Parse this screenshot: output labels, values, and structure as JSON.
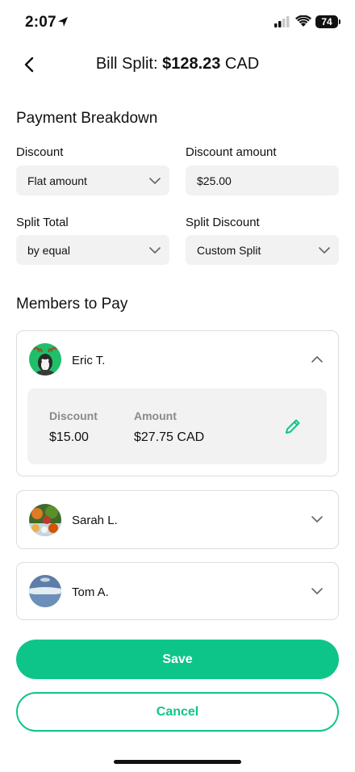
{
  "status_bar": {
    "time": "2:07",
    "battery": "74"
  },
  "header": {
    "title_prefix": "Bill Split: ",
    "title_amount": "$128.23",
    "title_currency": " CAD"
  },
  "breakdown": {
    "section_title": "Payment Breakdown",
    "discount_label": "Discount",
    "discount_type": "Flat amount",
    "discount_amount_label": "Discount amount",
    "discount_amount_value": "$25.00",
    "split_total_label": "Split Total",
    "split_total_value": "by equal",
    "split_discount_label": "Split Discount",
    "split_discount_value": "Custom Split"
  },
  "members": {
    "section_title": "Members to Pay",
    "list": [
      {
        "name": "Eric T.",
        "expanded": true,
        "discount_label": "Discount",
        "discount": "$15.00",
        "amount_label": "Amount",
        "amount": "$27.75 CAD"
      },
      {
        "name": "Sarah L.",
        "expanded": false
      },
      {
        "name": "Tom A.",
        "expanded": false
      }
    ]
  },
  "actions": {
    "save": "Save",
    "cancel": "Cancel"
  },
  "colors": {
    "accent": "#0ec589",
    "field_bg": "#f2f2f2",
    "border": "#dddddd"
  }
}
